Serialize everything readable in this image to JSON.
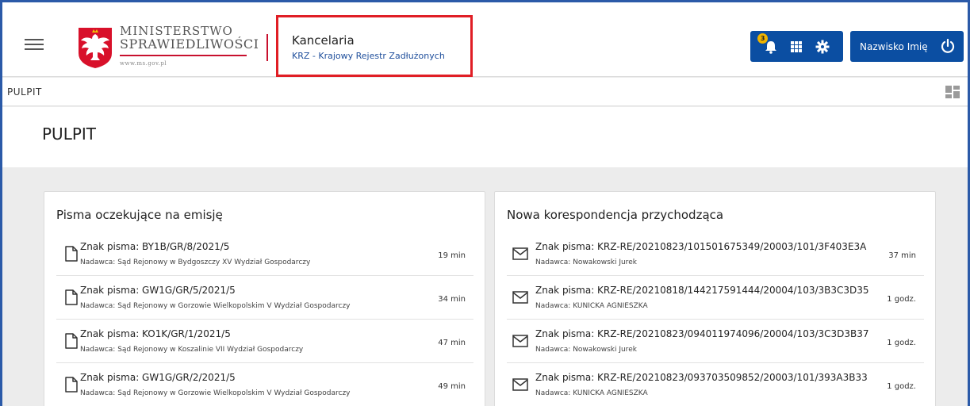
{
  "header": {
    "logo": {
      "line1": "MINISTERSTWO",
      "line2": "SPRAWIEDLIWOŚCI",
      "url": "www.ms.gov.pl"
    },
    "app_title": "Kancelaria",
    "app_subtitle": "KRZ - Krajowy Rejestr Zadłużonych",
    "notifications_count": "3",
    "user_name": "Nazwisko Imię",
    "accent_color": "#0b4ea2",
    "highlight_color": "#e01e25",
    "icons": [
      "menu-icon",
      "bell-icon",
      "apps-grid-icon",
      "gear-icon",
      "power-icon"
    ]
  },
  "breadcrumb": "PULPIT",
  "page_title": "PULPIT",
  "panels": {
    "left": {
      "title": "Pisma oczekujące na emisję",
      "items": [
        {
          "main": "Znak pisma: BY1B/GR/8/2021/5",
          "sub": "Nadawca: Sąd Rejonowy w Bydgoszczy XV Wydział Gospodarczy",
          "time": "19 min"
        },
        {
          "main": "Znak pisma: GW1G/GR/5/2021/5",
          "sub": "Nadawca: Sąd Rejonowy w Gorzowie Wielkopolskim V Wydział Gospodarczy",
          "time": "34 min"
        },
        {
          "main": "Znak pisma: KO1K/GR/1/2021/5",
          "sub": "Nadawca: Sąd Rejonowy w Koszalinie VII Wydział Gospodarczy",
          "time": "47 min"
        },
        {
          "main": "Znak pisma: GW1G/GR/2/2021/5",
          "sub": "Nadawca: Sąd Rejonowy w Gorzowie Wielkopolskim V Wydział Gospodarczy",
          "time": "49 min"
        }
      ]
    },
    "right": {
      "title": "Nowa korespondencja przychodząca",
      "items": [
        {
          "main": "Znak pisma: KRZ-RE/20210823/101501675349/20003/101/3F403E3A",
          "sub": "Nadawca: Nowakowski Jurek",
          "time": "37 min"
        },
        {
          "main": "Znak pisma: KRZ-RE/20210818/144217591444/20004/103/3B3C3D35",
          "sub": "Nadawca: KUNICKA AGNIESZKA",
          "time": "1 godz."
        },
        {
          "main": "Znak pisma: KRZ-RE/20210823/094011974096/20004/103/3C3D3B37",
          "sub": "Nadawca: Nowakowski Jurek",
          "time": "1 godz."
        },
        {
          "main": "Znak pisma: KRZ-RE/20210823/093703509852/20003/101/393A3B33",
          "sub": "Nadawca: KUNICKA AGNIESZKA",
          "time": "1 godz."
        }
      ]
    }
  }
}
